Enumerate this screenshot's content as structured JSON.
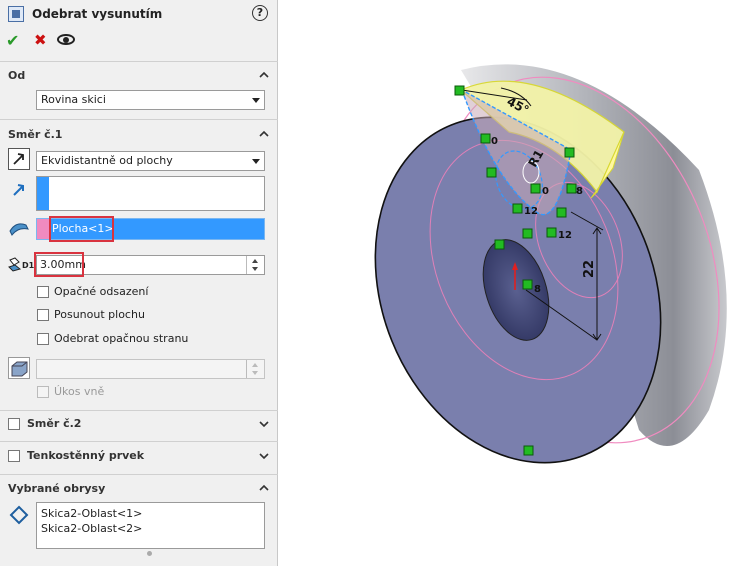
{
  "header": {
    "title": "Odebrat vysunutím",
    "help": "?"
  },
  "sections": {
    "from": {
      "title": "Od",
      "value": "Rovina skici"
    },
    "dir1": {
      "title": "Směr č.1",
      "end_condition": "Ekvidistantně od plochy",
      "face": "Plocha<1>",
      "offset": "3.00mm",
      "depth_icon_label": "D1",
      "options": [
        {
          "label": "Opačné odsazení",
          "checked": false
        },
        {
          "label": "Posunout plochu",
          "checked": false
        },
        {
          "label": "Odebrat opačnou stranu",
          "checked": false
        }
      ],
      "draft_label": "Úkos vně"
    },
    "dir2": {
      "title": "Směr č.2"
    },
    "thin": {
      "title": "Tenkostěnný prvek"
    },
    "contours": {
      "title": "Vybrané obrysy",
      "items": [
        "Skica2-Oblast<1>",
        "Skica2-Oblast<2>"
      ]
    }
  },
  "viewport": {
    "dims": {
      "angle": "45°",
      "radius": "R1",
      "length": "22"
    },
    "relation_labels": [
      "0",
      "0",
      "12",
      "12",
      "8",
      "8"
    ]
  },
  "colors": {
    "accent_blue": "#3399ff",
    "face_pink": "#f08bc0",
    "disk_face": "#7a7fad",
    "callout_red": "#d9333f",
    "relation_green": "#22bb22"
  }
}
